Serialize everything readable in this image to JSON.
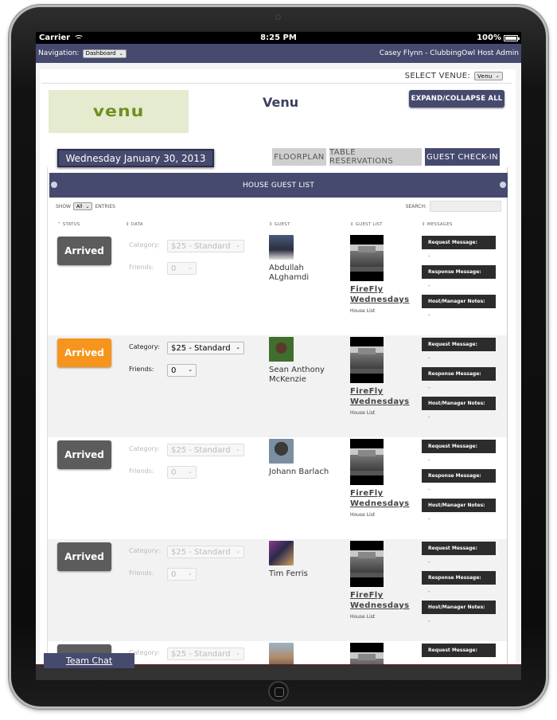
{
  "status_bar": {
    "carrier": "Carrier",
    "time": "8:25 PM",
    "battery": "100%",
    "battery_level": 1.0
  },
  "nav": {
    "label": "Navigation:",
    "selected": "Dashboard",
    "user": "Casey Flynn - ClubbingOwl Host Admin"
  },
  "venue_select": {
    "label": "SELECT VENUE:",
    "selected": "Venu"
  },
  "venue": {
    "logo_text": "venu",
    "name": "Venu",
    "expand_label": "EXPAND/COLLAPSE ALL",
    "date": "Wednesday January 30, 2013"
  },
  "tabs": [
    {
      "label": "FLOORPLAN"
    },
    {
      "label": "TABLE RESERVATIONS"
    },
    {
      "label": "GUEST CHECK-IN"
    }
  ],
  "list": {
    "title": "HOUSE GUEST LIST",
    "show_label": "SHOW",
    "show_value": "All",
    "entries_label": "ENTRIES",
    "search_label": "SEARCH:",
    "columns": [
      "STATUS",
      "DATA",
      "GUEST",
      "GUEST LIST",
      "MESSAGES"
    ],
    "category_label": "Category:",
    "friends_label": "Friends:",
    "msg_labels": [
      "Request Message:",
      "Response Message:",
      "Host/Manager Notes:"
    ],
    "rows": [
      {
        "status": "Arrived",
        "category": "$25 - Standard",
        "friends": "0",
        "guest": "Abdullah ALghamdi",
        "event_line1": "FireFly",
        "event_line2": "Wednesdays",
        "event_type": "House List",
        "msg1": "-",
        "msg2": "-",
        "msg3": "-"
      },
      {
        "status": "Arrived",
        "category": "$25 - Standard",
        "friends": "0",
        "guest": "Sean Anthony McKenzie",
        "event_line1": "FireFly",
        "event_line2": "Wednesdays",
        "event_type": "House List",
        "msg1": "-",
        "msg2": "-",
        "msg3": "-"
      },
      {
        "status": "Arrived",
        "category": "$25 - Standard",
        "friends": "0",
        "guest": "Johann Barlach",
        "event_line1": "FireFly",
        "event_line2": "Wednesdays",
        "event_type": "House List",
        "msg1": "-",
        "msg2": "-",
        "msg3": "-"
      },
      {
        "status": "Arrived",
        "category": "$25 - Standard",
        "friends": "0",
        "guest": "Tim Ferris",
        "event_line1": "FireFly",
        "event_line2": "Wednesdays",
        "event_type": "House List",
        "msg1": "-",
        "msg2": "-",
        "msg3": "-"
      },
      {
        "status": "",
        "category": "$25 - Standard",
        "friends": "",
        "guest": "",
        "event_line1": "",
        "event_line2": "",
        "event_type": "",
        "msg1": "",
        "msg2": "",
        "msg3": ""
      }
    ]
  },
  "team_chat": "Team Chat",
  "colors": {
    "nav": "#454a6e",
    "arrived": "#5c5c5c",
    "arrived_active": "#f7941d",
    "message_label": "#2c2c2c"
  }
}
